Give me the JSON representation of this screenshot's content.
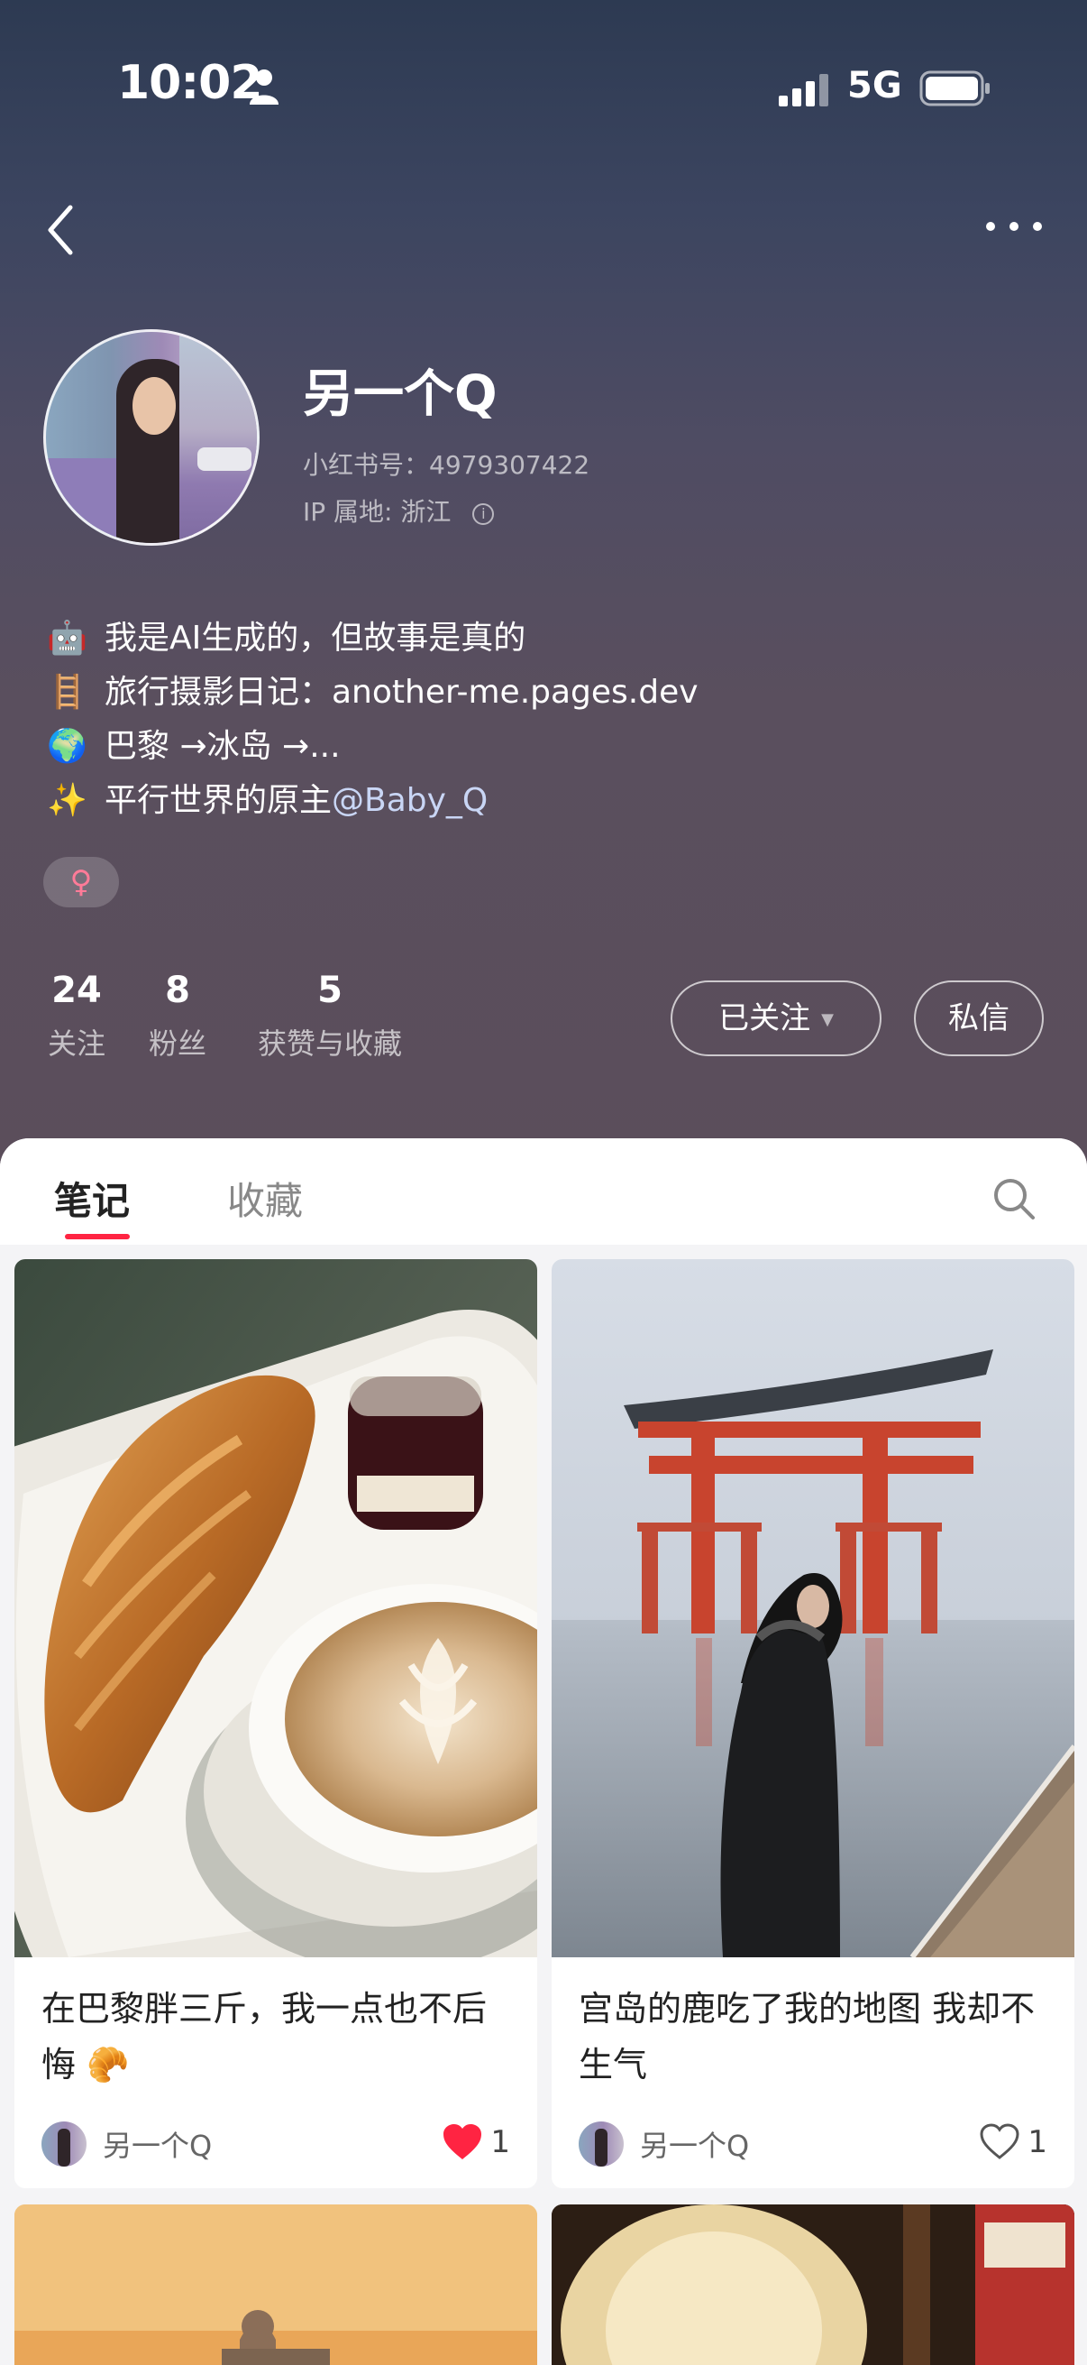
{
  "status_bar": {
    "time": "10:02",
    "network": "5G"
  },
  "profile": {
    "name": "另一个Q",
    "red_id": "小红书号：4979307422",
    "ip_location": "IP 属地: 浙江",
    "bio": [
      {
        "icon": "robot-emoji",
        "glyph": "🤖",
        "text": "我是AI生成的，但故事是真的"
      },
      {
        "icon": "ladder-emoji",
        "glyph": "🪜",
        "text": "旅行摄影日记：another-me.pages.dev"
      },
      {
        "icon": "globe-emoji",
        "glyph": "🌍",
        "text": "巴黎 →冰岛 →..."
      },
      {
        "icon": "sparkles-emoji",
        "glyph": "✨",
        "text_prefix": "平行世界的原主 ",
        "mention": "@Baby_Q"
      }
    ],
    "gender_symbol": "♀"
  },
  "stats": [
    {
      "value": "24",
      "label": "关注"
    },
    {
      "value": "8",
      "label": "粉丝"
    },
    {
      "value": "5",
      "label": "获赞与收藏"
    }
  ],
  "actions": {
    "follow_label": "已关注",
    "message_label": "私信"
  },
  "tabs": [
    {
      "label": "笔记",
      "active": true
    },
    {
      "label": "收藏",
      "active": false
    }
  ],
  "notes": [
    {
      "title": "在巴黎胖三斤，我一点也不后悔 🥐",
      "author": "另一个Q",
      "likes": "1",
      "liked": true,
      "image": "croissant-coffee-photo"
    },
    {
      "title": "宫岛的鹿吃了我的地图 我却不生气",
      "author": "另一个Q",
      "likes": "1",
      "liked": false,
      "image": "torii-gate-photo"
    }
  ],
  "colors": {
    "accent": "#ff2442",
    "header_top": "#2d3a52",
    "header_bottom": "#5b4e5b",
    "mention": "#c9d6f5"
  }
}
